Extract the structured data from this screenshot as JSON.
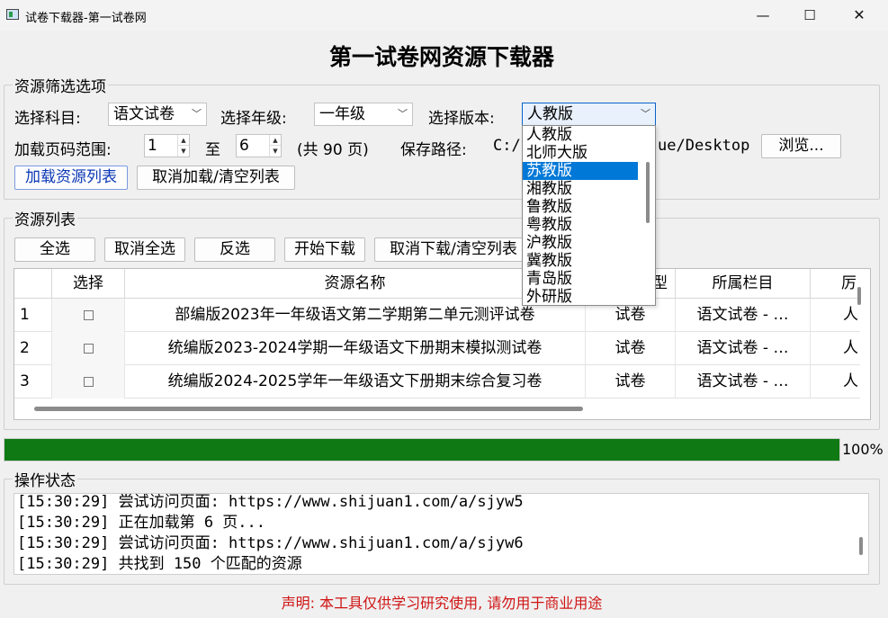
{
  "window": {
    "title": "试卷下载器-第一试卷网",
    "min_glyph": "—",
    "max_glyph": "☐",
    "close_glyph": "✕",
    "icon": "app-icon"
  },
  "main_title": "第一试卷网资源下载器",
  "filter": {
    "group_label": "资源筛选选项",
    "subject_label": "选择科目:",
    "subject_value": "语文试卷",
    "grade_label": "选择年级:",
    "grade_value": "一年级",
    "edition_label": "选择版本:",
    "edition_value": "人教版",
    "page_range_label": "加载页码范围:",
    "page_from": "1",
    "page_to_label": "至",
    "page_to": "6",
    "page_total": "(共 90 页)",
    "save_path_label": "保存路径:",
    "save_path_prefix": "C:/",
    "save_path_suffix": "ue/Desktop",
    "browse_label": "浏览...",
    "load_button": "加载资源列表",
    "cancel_load_button": "取消加载/清空列表"
  },
  "edition_options": [
    "人教版",
    "北师大版",
    "苏教版",
    "湘教版",
    "鲁教版",
    "粤教版",
    "沪教版",
    "冀教版",
    "青岛版",
    "外研版"
  ],
  "edition_highlighted": "苏教版",
  "resources": {
    "group_label": "资源列表",
    "select_all": "全选",
    "deselect_all": "取消全选",
    "invert": "反选",
    "start_download": "开始下载",
    "cancel_download": "取消下载/清空列表",
    "columns": [
      "选择",
      "资源名称",
      "型",
      "所属栏目",
      "厉"
    ],
    "rows": [
      {
        "num": "1",
        "name": "部编版2023年一年级语文第二学期第二单元测评试卷",
        "type": "试卷",
        "category": "语文试卷 - …",
        "extra": "人"
      },
      {
        "num": "2",
        "name": "统编版2023-2024学期一年级语文下册期末模拟测试卷",
        "type": "试卷",
        "category": "语文试卷 - …",
        "extra": "人"
      },
      {
        "num": "3",
        "name": "统编版2024-2025学年一年级语文下册期末综合复习卷",
        "type": "试卷",
        "category": "语文试卷 - …",
        "extra": "人"
      }
    ]
  },
  "progress": {
    "percent": 100,
    "label": "100%",
    "color": "#0f7a13"
  },
  "status": {
    "group_label": "操作状态",
    "lines": [
      "[15:30:29] 尝试访问页面: https://www.shijuan1.com/a/sjyw5",
      "[15:30:29] 正在加载第 6 页...",
      "[15:30:29] 尝试访问页面: https://www.shijuan1.com/a/sjyw6",
      "[15:30:29] 共找到 150 个匹配的资源"
    ]
  },
  "disclaimer": "声明: 本工具仅供学习研究使用, 请勿用于商业用途",
  "colors": {
    "accent": "#0078d7",
    "warning": "#d01515"
  }
}
